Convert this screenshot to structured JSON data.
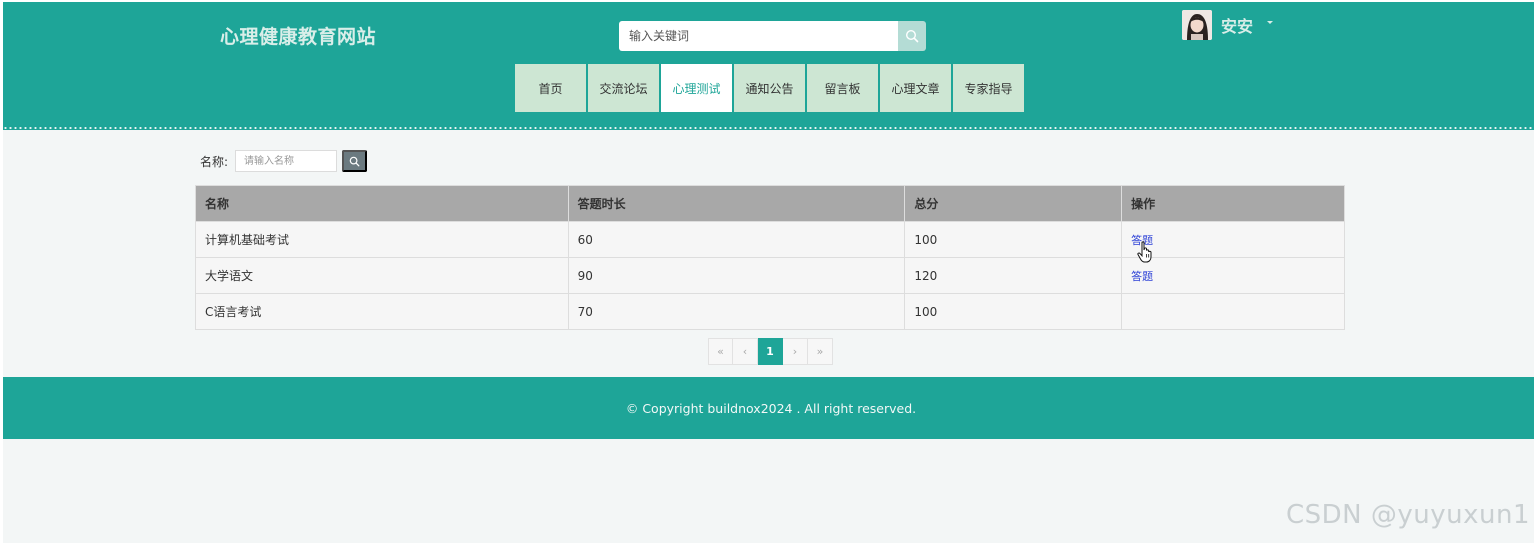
{
  "header": {
    "site_title": "心理健康教育网站",
    "search_placeholder": "输入关键词",
    "user": {
      "name": "安安"
    }
  },
  "nav": [
    {
      "label": "首页",
      "active": false
    },
    {
      "label": "交流论坛",
      "active": false
    },
    {
      "label": "心理测试",
      "active": true
    },
    {
      "label": "通知公告",
      "active": false
    },
    {
      "label": "留言板",
      "active": false
    },
    {
      "label": "心理文章",
      "active": false
    },
    {
      "label": "专家指导",
      "active": false
    }
  ],
  "filter": {
    "label": "名称:",
    "placeholder": "请输入名称"
  },
  "table": {
    "headers": [
      "名称",
      "答题时长",
      "总分",
      "操作"
    ],
    "rows": [
      {
        "name": "计算机基础考试",
        "duration": "60",
        "score": "100",
        "action": "答题"
      },
      {
        "name": "大学语文",
        "duration": "90",
        "score": "120",
        "action": "答题"
      },
      {
        "name": "C语言考试",
        "duration": "70",
        "score": "100",
        "action": ""
      }
    ]
  },
  "pagination": {
    "first": "«",
    "prev": "‹",
    "current": "1",
    "next": "›",
    "last": "»"
  },
  "footer": {
    "copyright": "© Copyright buildnox2024 . All right reserved."
  },
  "watermark": "CSDN @yuyuxun1",
  "colors": {
    "primary": "#1ea598",
    "nav_bg": "#cde6d3",
    "link": "#2b3fd6"
  }
}
